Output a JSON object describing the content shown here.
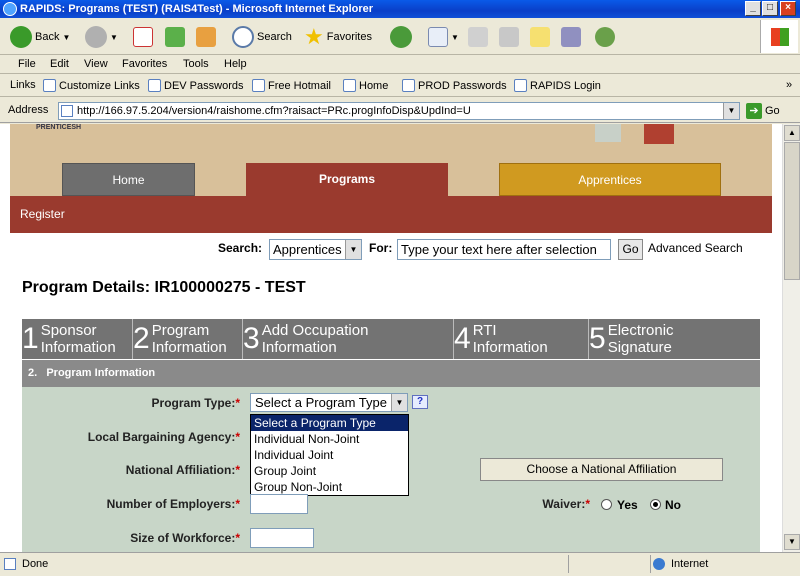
{
  "window": {
    "title": "RAPIDS: Programs  (TEST) (RAIS4Test) - Microsoft Internet Explorer"
  },
  "toolbar": {
    "back": "Back",
    "search": "Search",
    "favorites": "Favorites"
  },
  "menu": [
    "File",
    "Edit",
    "View",
    "Favorites",
    "Tools",
    "Help"
  ],
  "links": {
    "label": "Links",
    "items": [
      "Customize Links",
      "DEV Passwords",
      "Free Hotmail",
      "Home",
      "PROD Passwords",
      "RAPIDS Login"
    ]
  },
  "address": {
    "label": "Address",
    "url": "http://166.97.5.204/version4/raishome.cfm?raisact=PRc.progInfoDisp&UpdInd=U",
    "go": "Go"
  },
  "site": {
    "logo_text": "PRENTICESH",
    "tabs": [
      "Home",
      "Programs",
      "Apprentices"
    ],
    "subnav": "Register",
    "search_label": "Search:",
    "search_select": "Apprentices",
    "for_label": "For:",
    "search_placeholder": "Type your text here after selection",
    "go": "Go",
    "advanced": "Advanced Search",
    "page_title": "Program Details: IR100000275 - TEST",
    "steps": [
      {
        "num": "1",
        "line1": "Sponsor",
        "line2": "Information"
      },
      {
        "num": "2",
        "line1": "Program",
        "line2": "Information"
      },
      {
        "num": "3",
        "line1": "Add Occupation",
        "line2": "Information"
      },
      {
        "num": "4",
        "line1": "RTI",
        "line2": "Information"
      },
      {
        "num": "5",
        "line1": "Electronic",
        "line2": "Signature"
      }
    ],
    "section_header": "2.   Program Information",
    "labels": {
      "program_type": "Program Type:",
      "local_bargaining": "Local Bargaining Agency:",
      "national_affiliation": "National Affiliation:",
      "num_employers": "Number of Employers:",
      "size_workforce": "Size of Workforce:",
      "waiver": "Waiver:"
    },
    "required_mark": "*",
    "program_type_selected": "Select a Program Type",
    "program_type_options": [
      "Select a Program Type",
      "Individual Non-Joint",
      "Individual Joint",
      "Group Joint",
      "Group Non-Joint"
    ],
    "help": "?",
    "choose_affiliation": "Choose a National Affiliation",
    "waiver_yes": "Yes",
    "waiver_no": "No"
  },
  "status": {
    "text": "Done",
    "zone": "Internet"
  },
  "colors": {
    "tan": "#d8c09a",
    "tab_grey": "#6e6e6e",
    "tab_red": "#9a3a2e",
    "tab_gold": "#d09a20",
    "step_grey": "#737373",
    "section_grey": "#8a8a8a",
    "form_bg": "#c8d6c8"
  }
}
